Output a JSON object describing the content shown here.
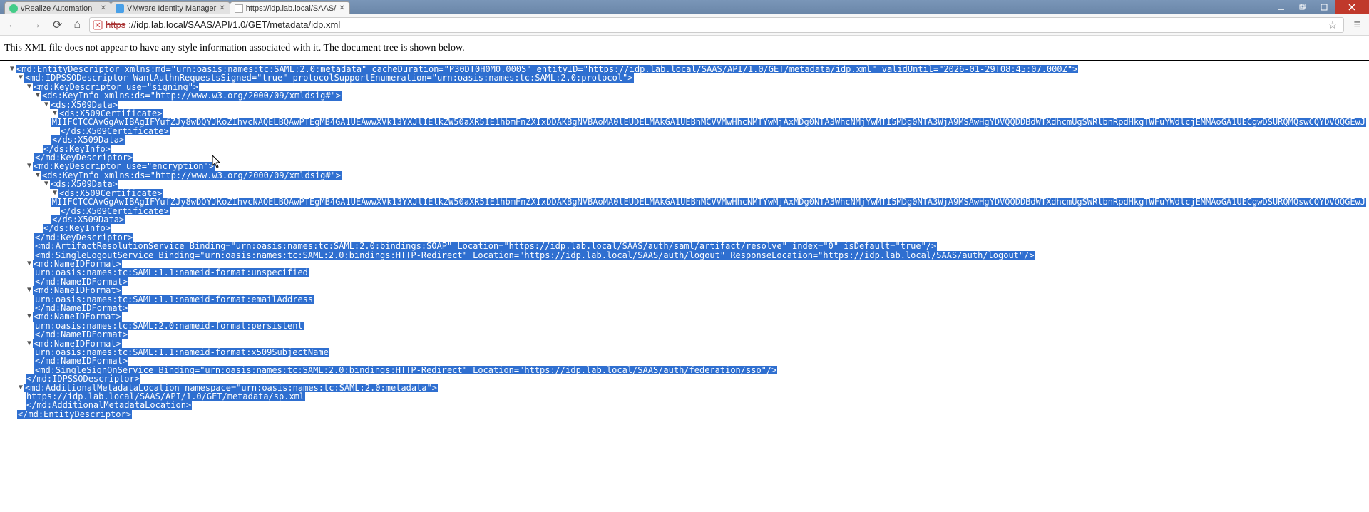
{
  "window": {
    "tabs": [
      {
        "title": "vRealize Automation"
      },
      {
        "title": "VMware Identity Manager"
      },
      {
        "title": "https://idp.lab.local/SAAS/"
      }
    ]
  },
  "toolbar": {
    "url_insecure_prefix": "https",
    "url_rest": "://idp.lab.local/SAAS/API/1.0/GET/metadata/idp.xml"
  },
  "banner": {
    "text": "This XML file does not appear to have any style information associated with it. The document tree is shown below."
  },
  "xml": {
    "l01": "<md:EntityDescriptor xmlns:md=\"urn:oasis:names:tc:SAML:2.0:metadata\" cacheDuration=\"P30DT0H0M0.000S\" entityID=\"https://idp.lab.local/SAAS/API/1.0/GET/metadata/idp.xml\" validUntil=\"2026-01-29T08:45:07.000Z\">",
    "l02": "<md:IDPSSODescriptor WantAuthnRequestsSigned=\"true\" protocolSupportEnumeration=\"urn:oasis:names:tc:SAML:2.0:protocol\">",
    "l03": "<md:KeyDescriptor use=\"signing\">",
    "l04": "<ds:KeyInfo xmlns:ds=\"http://www.w3.org/2000/09/xmldsig#\">",
    "l05": "<ds:X509Data>",
    "l06": "<ds:X509Certificate>",
    "l07": "MIIFCTCCAvGgAwIBAgIFYufZJy8wDQYJKoZIhvcNAQELBQAwPTEgMB4GA1UEAwwXVk13YXJlIElkZW50aXR5IE1hbmFnZXIxDDAKBgNVBAoMA0lEUDELMAkGA1UEBhMCVVMwHhcNMTYwMjAxMDg0NTA3WhcNMjYwMTI5MDg0NTA3WjA9MSAwHgYDVQQDDBdWTXdhcmUgSWRlbnRpdHkgTWFuYWdlcjEMMAoGA1UECgwDSURQMQswCQYDVQQGEwJ",
    "l08": "</ds:X509Certificate>",
    "l09": "</ds:X509Data>",
    "l10": "</ds:KeyInfo>",
    "l11": "</md:KeyDescriptor>",
    "l12": "<md:KeyDescriptor use=\"encryption\">",
    "l13": "<ds:KeyInfo xmlns:ds=\"http://www.w3.org/2000/09/xmldsig#\">",
    "l14": "<ds:X509Data>",
    "l15": "<ds:X509Certificate>",
    "l16": "MIIFCTCCAvGgAwIBAgIFYufZJy8wDQYJKoZIhvcNAQELBQAwPTEgMB4GA1UEAwwXVk13YXJlIElkZW50aXR5IE1hbmFnZXIxDDAKBgNVBAoMA0lEUDELMAkGA1UEBhMCVVMwHhcNMTYwMjAxMDg0NTA3WhcNMjYwMTI5MDg0NTA3WjA9MSAwHgYDVQQDDBdWTXdhcmUgSWRlbnRpdHkgTWFuYWdlcjEMMAoGA1UECgwDSURQMQswCQYDVQQGEwJ",
    "l17": "</ds:X509Certificate>",
    "l18": "</ds:X509Data>",
    "l19": "</ds:KeyInfo>",
    "l20": "</md:KeyDescriptor>",
    "l21": "<md:ArtifactResolutionService Binding=\"urn:oasis:names:tc:SAML:2.0:bindings:SOAP\" Location=\"https://idp.lab.local/SAAS/auth/saml/artifact/resolve\" index=\"0\" isDefault=\"true\"/>",
    "l22": "<md:SingleLogoutService Binding=\"urn:oasis:names:tc:SAML:2.0:bindings:HTTP-Redirect\" Location=\"https://idp.lab.local/SAAS/auth/logout\" ResponseLocation=\"https://idp.lab.local/SAAS/auth/logout\"/>",
    "l23": "<md:NameIDFormat>",
    "l24": "urn:oasis:names:tc:SAML:1.1:nameid-format:unspecified",
    "l25": "</md:NameIDFormat>",
    "l26": "<md:NameIDFormat>",
    "l27": "urn:oasis:names:tc:SAML:1.1:nameid-format:emailAddress",
    "l28": "</md:NameIDFormat>",
    "l29": "<md:NameIDFormat>",
    "l30": "urn:oasis:names:tc:SAML:2.0:nameid-format:persistent",
    "l31": "</md:NameIDFormat>",
    "l32": "<md:NameIDFormat>",
    "l33": "urn:oasis:names:tc:SAML:1.1:nameid-format:x509SubjectName",
    "l34": "</md:NameIDFormat>",
    "l35": "<md:SingleSignOnService Binding=\"urn:oasis:names:tc:SAML:2.0:bindings:HTTP-Redirect\" Location=\"https://idp.lab.local/SAAS/auth/federation/sso\"/>",
    "l36": "</md:IDPSSODescriptor>",
    "l37": "<md:AdditionalMetadataLocation namespace=\"urn:oasis:names:tc:SAML:2.0:metadata\">",
    "l38": "https://idp.lab.local/SAAS/API/1.0/GET/metadata/sp.xml",
    "l39": "</md:AdditionalMetadataLocation>",
    "l40": "</md:EntityDescriptor>"
  }
}
